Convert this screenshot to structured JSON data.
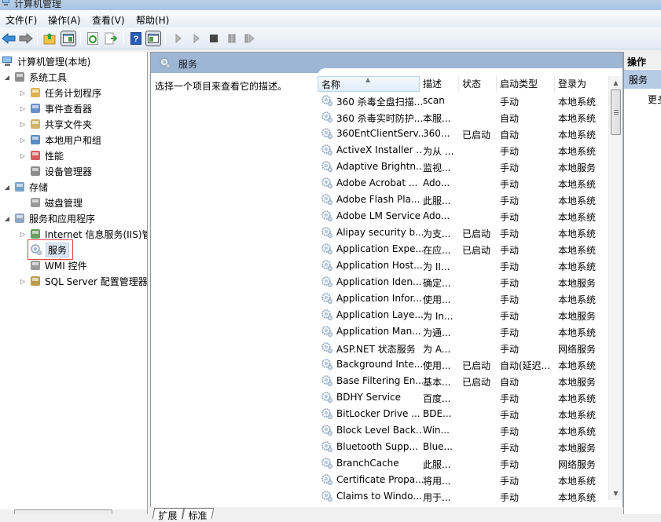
{
  "window": {
    "title": "计算机管理"
  },
  "menu": [
    {
      "label": "文件(F)"
    },
    {
      "label": "操作(A)"
    },
    {
      "label": "查看(V)"
    },
    {
      "label": "帮助(H)"
    }
  ],
  "toolbar": {
    "buttons": [
      "back-icon",
      "forward-icon",
      "up-folder-icon",
      "show-hide-tree-icon",
      "refresh-icon",
      "export-list-icon",
      "help-icon",
      "show-hide-action-pane-icon",
      "start-service-icon",
      "start-service-alt-icon",
      "stop-service-icon",
      "pause-service-icon",
      "restart-service-icon"
    ]
  },
  "tree": {
    "root": "计算机管理(本地)",
    "nodes": [
      {
        "label": "系统工具",
        "level": 1,
        "expander": "expanded"
      },
      {
        "label": "任务计划程序",
        "level": 2,
        "expander": "collapsed"
      },
      {
        "label": "事件查看器",
        "level": 2,
        "expander": "collapsed"
      },
      {
        "label": "共享文件夹",
        "level": 2,
        "expander": "collapsed"
      },
      {
        "label": "本地用户和组",
        "level": 2,
        "expander": "collapsed"
      },
      {
        "label": "性能",
        "level": 2,
        "expander": "collapsed"
      },
      {
        "label": "设备管理器",
        "level": 2,
        "expander": "none"
      },
      {
        "label": "存储",
        "level": 1,
        "expander": "expanded"
      },
      {
        "label": "磁盘管理",
        "level": 2,
        "expander": "none"
      },
      {
        "label": "服务和应用程序",
        "level": 1,
        "expander": "expanded"
      },
      {
        "label": "Internet 信息服务(IIS)管",
        "level": 2,
        "expander": "collapsed"
      },
      {
        "label": "服务",
        "level": 2,
        "expander": "none",
        "selected": true
      },
      {
        "label": "WMI 控件",
        "level": 2,
        "expander": "none"
      },
      {
        "label": "SQL Server 配置管理器",
        "level": 2,
        "expander": "collapsed"
      }
    ]
  },
  "center": {
    "header": "服务",
    "description": "选择一个项目来查看它的描述。",
    "columns": [
      "名称",
      "描述",
      "状态",
      "启动类型",
      "登录为"
    ],
    "rows": [
      [
        "360 杀毒全盘扫描...",
        "scan",
        "",
        "手动",
        "本地系统"
      ],
      [
        "360 杀毒实时防护...",
        "本服...",
        "",
        "自动",
        "本地系统"
      ],
      [
        "360EntClientServ...",
        "360...",
        "已启动",
        "自动",
        "本地系统"
      ],
      [
        "ActiveX Installer ...",
        "为从 ...",
        "",
        "手动",
        "本地系统"
      ],
      [
        "Adaptive Brightn...",
        "监视...",
        "",
        "手动",
        "本地服务"
      ],
      [
        "Adobe Acrobat ...",
        "Ado...",
        "",
        "手动",
        "本地系统"
      ],
      [
        "Adobe Flash Pla...",
        "此服...",
        "",
        "手动",
        "本地系统"
      ],
      [
        "Adobe LM Service",
        "Ado...",
        "",
        "手动",
        "本地系统"
      ],
      [
        "Alipay security b...",
        "为支...",
        "已启动",
        "手动",
        "本地系统"
      ],
      [
        "Application Expe...",
        "在应...",
        "已启动",
        "手动",
        "本地系统"
      ],
      [
        "Application Host...",
        "为 II...",
        "",
        "手动",
        "本地系统"
      ],
      [
        "Application Iden...",
        "确定...",
        "",
        "手动",
        "本地服务"
      ],
      [
        "Application Infor...",
        "使用...",
        "",
        "手动",
        "本地系统"
      ],
      [
        "Application Laye...",
        "为 In...",
        "",
        "手动",
        "本地服务"
      ],
      [
        "Application Man...",
        "为通...",
        "",
        "手动",
        "本地系统"
      ],
      [
        "ASP.NET 状态服务",
        "为 A...",
        "",
        "手动",
        "网络服务"
      ],
      [
        "Background Inte...",
        "使用...",
        "已启动",
        "自动(延迟...",
        "本地系统"
      ],
      [
        "Base Filtering En...",
        "基本...",
        "已启动",
        "自动",
        "本地服务"
      ],
      [
        "BDHY Service",
        "百度...",
        "",
        "手动",
        "本地系统"
      ],
      [
        "BitLocker Drive ...",
        "BDE...",
        "",
        "手动",
        "本地系统"
      ],
      [
        "Block Level Back...",
        "Win...",
        "",
        "手动",
        "本地系统"
      ],
      [
        "Bluetooth Supp...",
        "Blue...",
        "",
        "手动",
        "本地服务"
      ],
      [
        "BranchCache",
        "此服...",
        "",
        "手动",
        "网络服务"
      ],
      [
        "Certificate Propa...",
        "将用...",
        "",
        "手动",
        "本地系统"
      ],
      [
        "Claims to Windo...",
        "用于...",
        "",
        "手动",
        "本地系统"
      ]
    ],
    "tabs": [
      "扩展",
      "标准"
    ]
  },
  "actions": {
    "title": "操作",
    "group": "服务",
    "more": "更多操作"
  },
  "colors": {
    "header_bg": "#9db6d4",
    "selected_outline": "#e0484a",
    "action_group_bg": "#b6cbe4"
  }
}
